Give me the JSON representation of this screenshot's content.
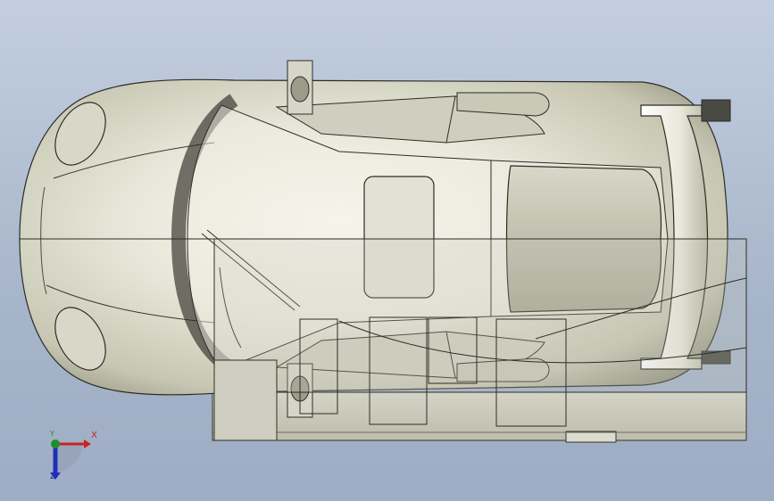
{
  "viewport": {
    "background_top": "#c3cfe0",
    "background_bottom": "#9eadc4",
    "model_name": "race car",
    "view": "top"
  },
  "triad": {
    "x_label": "X",
    "y_label": "Y",
    "z_label": "Z",
    "x_color": "#d02020",
    "y_color": "#1d8f2a",
    "z_color": "#1f2fb8"
  }
}
